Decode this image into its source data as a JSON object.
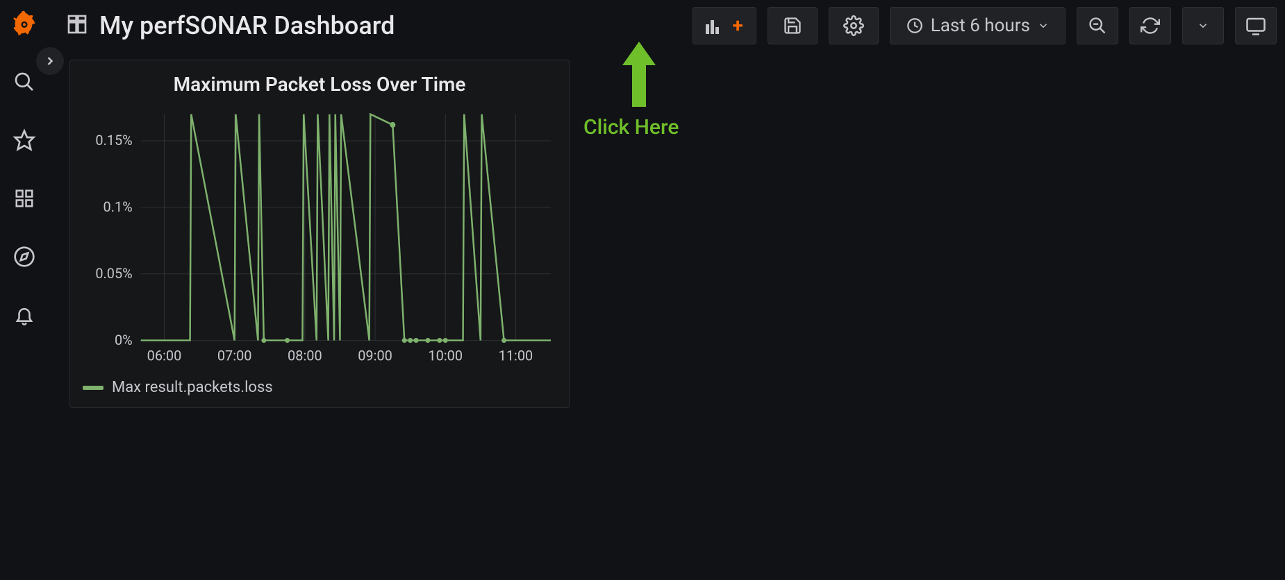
{
  "sidebar": {
    "items": [
      {
        "name": "logo",
        "icon": "grafana"
      },
      {
        "name": "search",
        "icon": "search"
      },
      {
        "name": "starred",
        "icon": "star"
      },
      {
        "name": "dashboards",
        "icon": "apps"
      },
      {
        "name": "explore",
        "icon": "compass"
      },
      {
        "name": "alerting",
        "icon": "bell"
      }
    ],
    "expand_tooltip": "Expand"
  },
  "header": {
    "dashboard_icon": "dashboard-grid",
    "title": "My perfSONAR Dashboard",
    "buttons": {
      "add_panel": "Add panel",
      "save": "Save dashboard",
      "settings": "Dashboard settings",
      "time_range_label": "Last 6 hours",
      "zoom_out": "Zoom out",
      "refresh": "Refresh",
      "refresh_menu": "Refresh options",
      "tv_mode": "Cycle view mode"
    }
  },
  "panel": {
    "title": "Maximum Packet Loss Over Time",
    "legend_label": "Max result.packets.loss"
  },
  "annotation_text": "Click Here",
  "chart_data": {
    "type": "line",
    "title": "Maximum Packet Loss Over Time",
    "xlabel": "",
    "ylabel": "",
    "y_ticks": [
      "0%",
      "0.05%",
      "0.1%",
      "0.15%"
    ],
    "ylim": [
      0,
      0.17
    ],
    "x_ticks": [
      "06:00",
      "07:00",
      "08:00",
      "09:00",
      "10:00",
      "11:00"
    ],
    "x_range": [
      "05:40",
      "11:30"
    ],
    "series": [
      {
        "name": "Max result.packets.loss",
        "color": "#7eb26d",
        "x": [
          "05:40",
          "06:22",
          "06:23",
          "07:00",
          "07:01",
          "07:20",
          "07:21",
          "07:25",
          "07:45",
          "07:58",
          "07:59",
          "08:10",
          "08:11",
          "08:20",
          "08:21",
          "08:25",
          "08:26",
          "08:30",
          "08:31",
          "08:55",
          "08:56",
          "09:15",
          "09:25",
          "09:30",
          "09:35",
          "09:45",
          "09:55",
          "10:00",
          "10:15",
          "10:16",
          "10:30",
          "10:31",
          "10:50",
          "11:30"
        ],
        "values": [
          0,
          0,
          0.17,
          0,
          0.17,
          0,
          0.17,
          0,
          0,
          0,
          0.17,
          0,
          0.17,
          0,
          0.17,
          0,
          0.17,
          0,
          0.17,
          0,
          0.17,
          0.162,
          0,
          0,
          0,
          0,
          0,
          0,
          0,
          0.17,
          0,
          0.17,
          0,
          0
        ]
      }
    ]
  }
}
